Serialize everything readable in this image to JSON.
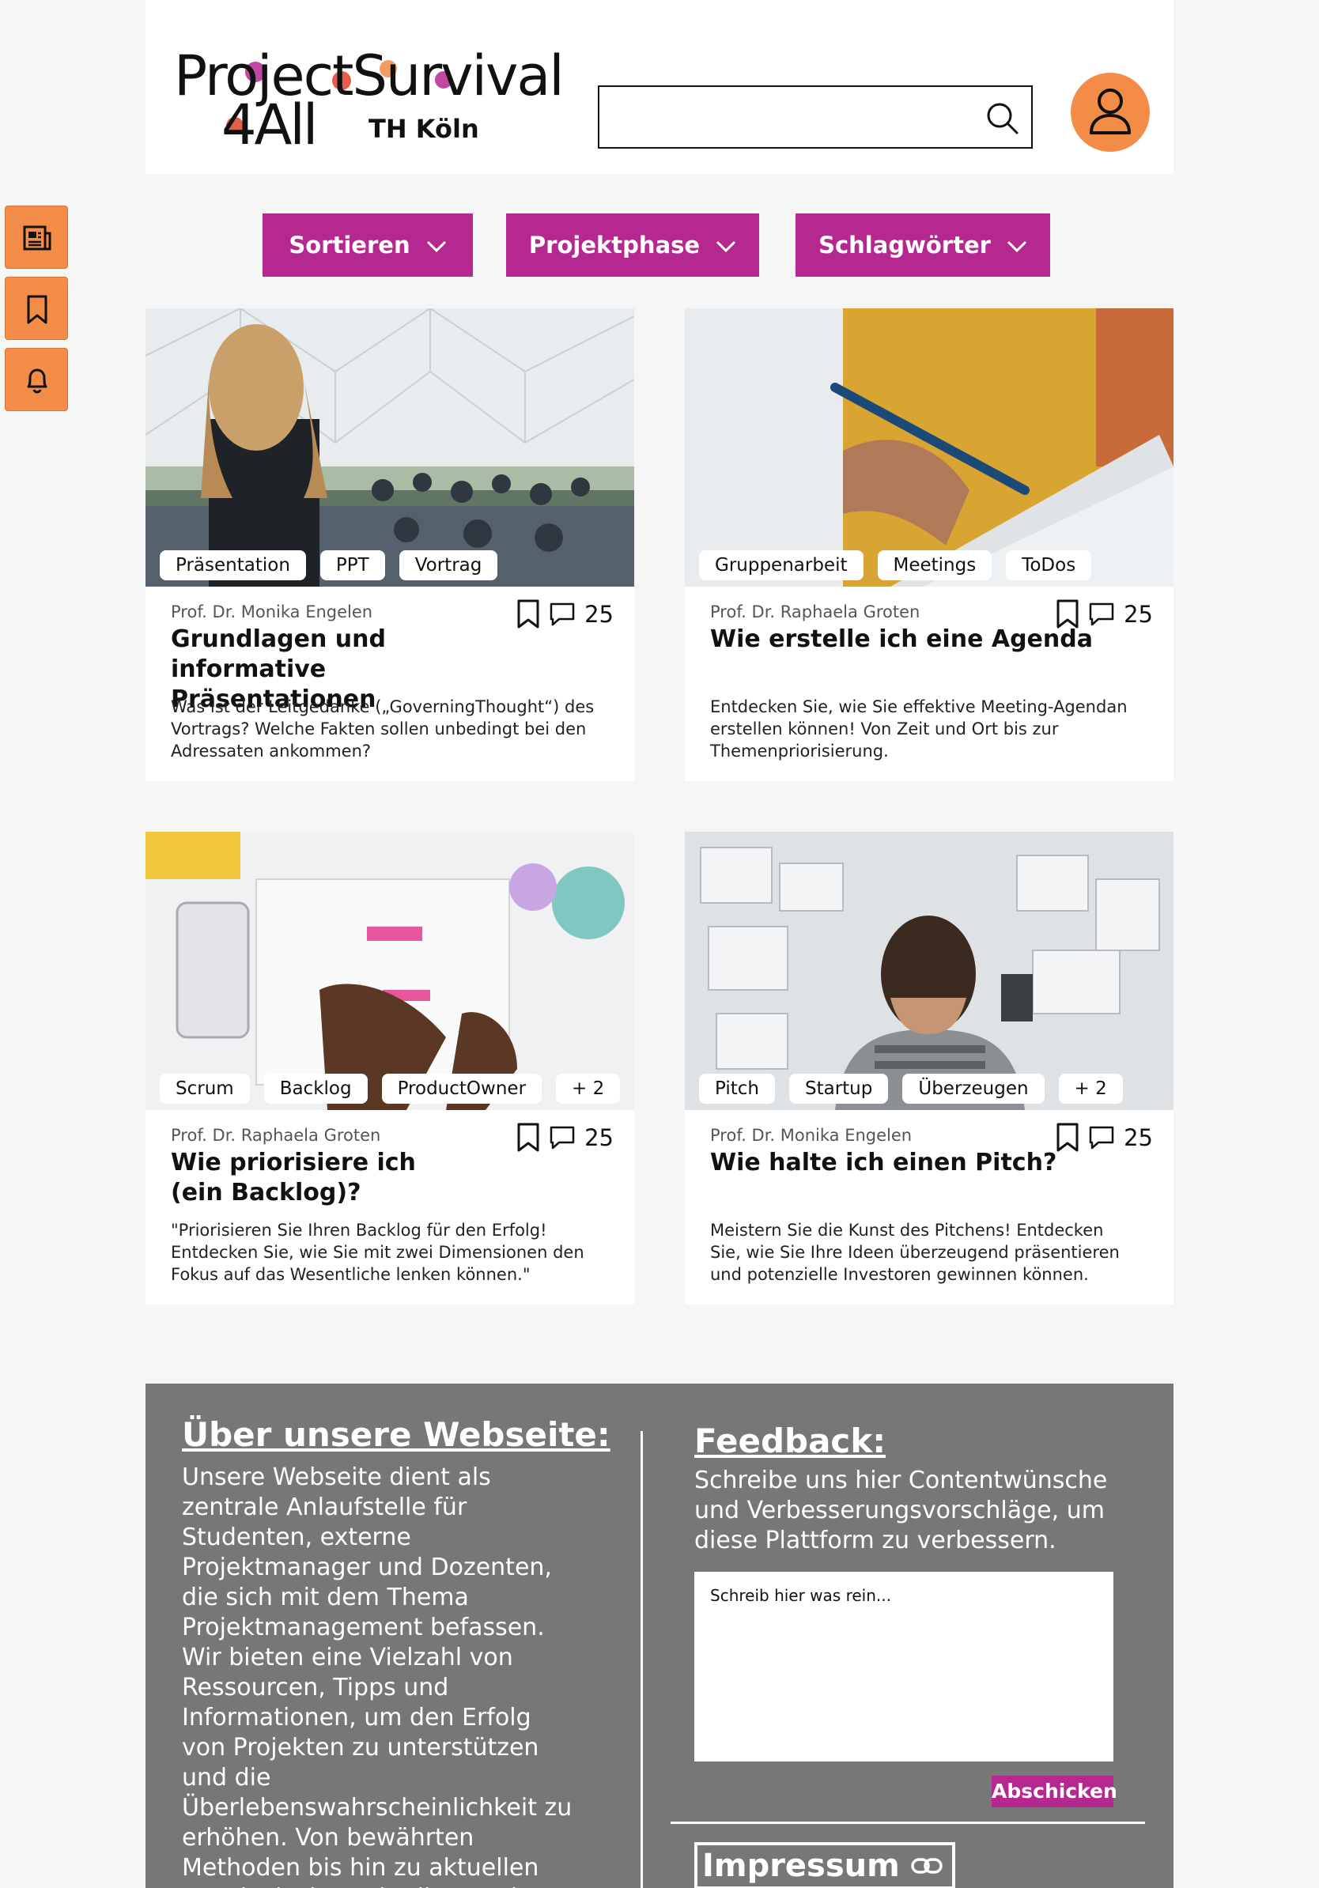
{
  "logo": {
    "line1": "ProjectSurvival",
    "line2": "4All",
    "institution": "TH Köln"
  },
  "search": {
    "value": "",
    "placeholder": ""
  },
  "icons": {
    "search": "search-icon",
    "user": "user-icon",
    "news": "newspaper-icon",
    "bookmark": "bookmark-icon",
    "bell": "bell-icon",
    "comment": "comment-icon",
    "chevron": "chevron-down-icon",
    "link": "link-icon"
  },
  "colors": {
    "accent": "#b5288f",
    "orange": "#f28c46",
    "footer": "#777777",
    "background": "#f6f6f6"
  },
  "filters": [
    {
      "label": "Sortieren"
    },
    {
      "label": "Projektphase"
    },
    {
      "label": "Schlagwörter"
    }
  ],
  "cards": [
    {
      "tags": [
        "Präsentation",
        "PPT",
        "Vortrag"
      ],
      "author": "Prof. Dr. Monika Engelen",
      "comments": "25",
      "title": "Grundlagen und informative Präsentationen",
      "description": "Was ist der Leitgedanke („GoverningThought“) des Vortrags? Welche Fakten  sollen unbedingt bei den Adressaten ankommen?"
    },
    {
      "tags": [
        "Gruppenarbeit",
        "Meetings",
        "ToDos"
      ],
      "author": "Prof. Dr. Raphaela Groten",
      "comments": "25",
      "title": "Wie erstelle ich eine Agenda",
      "description": "Entdecken Sie, wie Sie effektive Meeting-Agendan erstellen können! Von Zeit und Ort bis zur Themenpriorisierung."
    },
    {
      "tags": [
        "Scrum",
        "Backlog",
        "ProductOwner",
        "+ 2"
      ],
      "author": "Prof. Dr. Raphaela Groten",
      "comments": "25",
      "title": "Wie priorisiere ich (ein Backlog)?",
      "description": "\"Priorisieren Sie Ihren Backlog für den Erfolg! Entdecken Sie, wie Sie mit zwei Dimensionen den Fokus auf das Wesentliche lenken können.\""
    },
    {
      "tags": [
        "Pitch",
        "Startup",
        "Überzeugen",
        "+ 2"
      ],
      "author": "Prof. Dr. Monika Engelen",
      "comments": "25",
      "title": "Wie halte ich einen Pitch?",
      "description": "Meistern Sie die Kunst des Pitchens! Entdecken Sie, wie Sie Ihre Ideen überzeugend präsentieren und potenzielle Investoren gewinnen können."
    }
  ],
  "footer": {
    "about_title": "Über unsere Webseite:",
    "about_text": "Unsere Webseite dient als zentrale Anlaufstelle für Studenten, externe Projektmanager und Dozenten, die sich mit dem Thema Projektmanagement befassen. Wir bieten eine Vielzahl von Ressourcen, Tipps und Informationen, um den Erfolg von Projekten zu unterstützen und die Überlebenswahrscheinlichkeit zu erhöhen. Von bewährten Methoden bis hin zu aktuellen Trends decken wir alle Aspekte des Projektmanagements ab, um unseren",
    "feedback_title": "Feedback:",
    "feedback_text": "Schreibe uns hier Contentwünsche und Verbesserungsvorschläge, um diese Plattform zu verbessern.",
    "feedback_placeholder": "Schreib hier was rein...",
    "submit_label": "Abschicken",
    "impressum_label": "Impressum"
  }
}
